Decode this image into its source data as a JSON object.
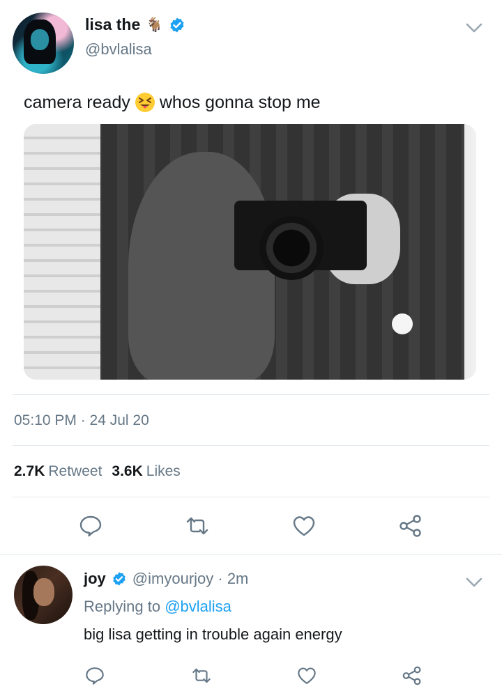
{
  "tweet": {
    "display_name": "lisa the",
    "name_emoji": "🐐",
    "handle": "@bvlalisa",
    "text_before": "camera ready",
    "text_emoji": "😝",
    "text_after": "whos gonna stop me",
    "timestamp": "05:10 PM · 24 Jul 20",
    "stats": {
      "retweets_count": "2.7K",
      "retweets_label": "Retweet",
      "likes_count": "3.6K",
      "likes_label": "Likes"
    }
  },
  "reply": {
    "display_name": "joy",
    "handle_time": "@imyourjoy · 2m",
    "replying_prefix": "Replying to",
    "replying_to": "@bvlalisa",
    "text": "big lisa getting in trouble again energy"
  },
  "colors": {
    "accent": "#1da1f2",
    "secondary_text": "#657786",
    "divider": "#e1e8ed",
    "icon": "#657786"
  },
  "icons": {
    "verified": "verified-badge-icon",
    "more": "chevron-down-icon",
    "reply": "reply-bubble-icon",
    "retweet": "retweet-icon",
    "like": "heart-icon",
    "share": "share-icon"
  }
}
